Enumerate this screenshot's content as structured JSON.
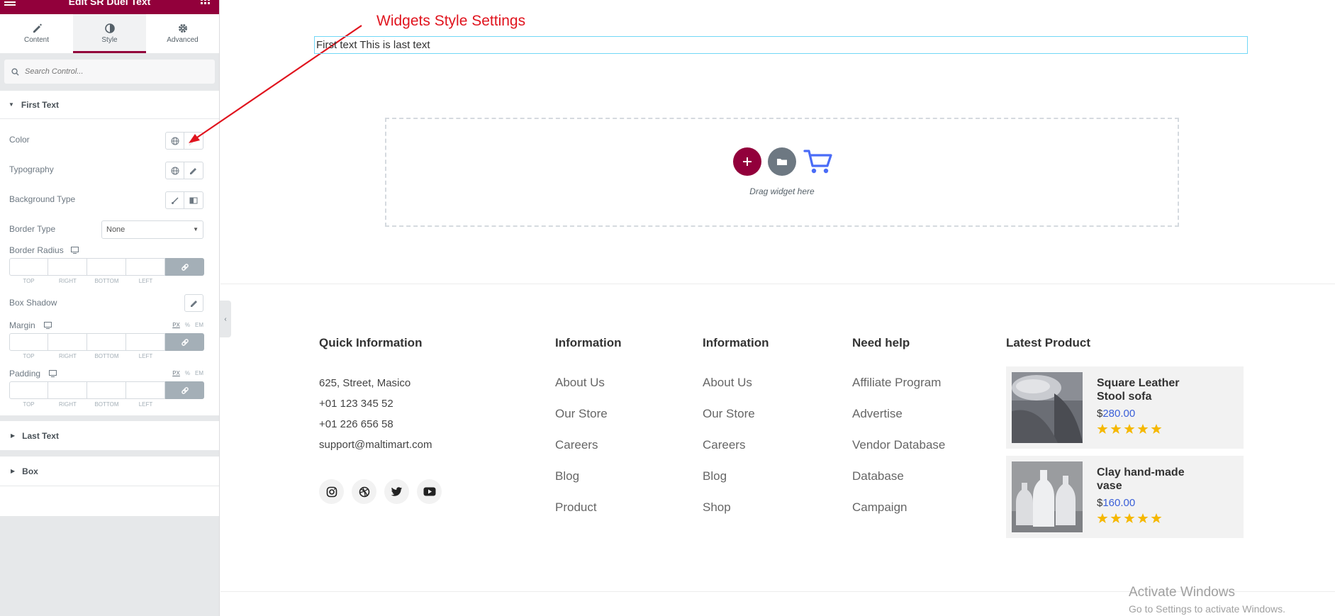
{
  "panel": {
    "title": "Edit SR Duel Text",
    "tabs": [
      {
        "label": "Content",
        "icon": "pencil-icon"
      },
      {
        "label": "Style",
        "icon": "contrast-icon"
      },
      {
        "label": "Advanced",
        "icon": "gear-icon"
      }
    ],
    "active_tab": "Style",
    "search_placeholder": "Search Control...",
    "first_text_section": {
      "title": "First Text",
      "color_label": "Color",
      "typography_label": "Typography",
      "background_type_label": "Background Type",
      "border_type_label": "Border Type",
      "border_type_value": "None",
      "border_radius_label": "Border Radius",
      "box_shadow_label": "Box Shadow",
      "margin_label": "Margin",
      "padding_label": "Padding",
      "dim_captions": [
        "TOP",
        "RIGHT",
        "BOTTOM",
        "LEFT"
      ],
      "units": [
        "PX",
        "%",
        "EM"
      ]
    },
    "last_text_section": "Last Text",
    "box_section": "Box"
  },
  "canvas": {
    "annotation": "Widgets Style Settings",
    "widget_text": "First text This is last text",
    "dropzone_text": "Drag widget here"
  },
  "footer": {
    "quick": {
      "title": "Quick Information",
      "lines": [
        "625, Street, Masico",
        "+01 123 345 52",
        "+01 226 656 58",
        "support@maltimart.com"
      ]
    },
    "info1": {
      "title": "Information",
      "links": [
        "About Us",
        "Our Store",
        "Careers",
        "Blog",
        "Product"
      ]
    },
    "info2": {
      "title": "Information",
      "links": [
        "About Us",
        "Our Store",
        "Careers",
        "Blog",
        "Shop"
      ]
    },
    "help": {
      "title": "Need help",
      "links": [
        "Affiliate Program",
        "Advertise",
        "Vendor Database",
        "Database",
        "Campaign"
      ]
    },
    "latest": {
      "title": "Latest Product",
      "products": [
        {
          "name": "Square Leather Stool sofa",
          "currency": "$",
          "price": "280.00",
          "rating": 5
        },
        {
          "name": "Clay hand-made vase",
          "currency": "$",
          "price": "160.00",
          "rating": 5
        }
      ]
    },
    "socials": [
      "instagram-icon",
      "dribbble-icon",
      "twitter-icon",
      "youtube-icon"
    ]
  },
  "watermark": {
    "line1": "Activate Windows",
    "line2": "Go to Settings to activate Windows."
  },
  "colors": {
    "brand": "#92003b",
    "link_blue": "#3a5fd8",
    "star": "#f5b800",
    "annotation_red": "#e0141e"
  }
}
